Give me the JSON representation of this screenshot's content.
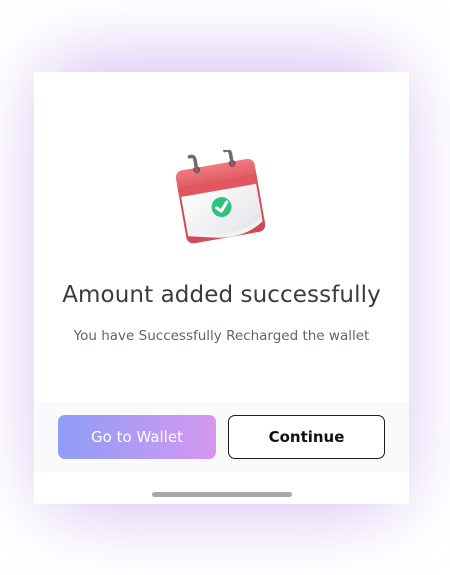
{
  "dialog": {
    "title": "Amount added successfully",
    "message": "You have Successfully Recharged the wallet"
  },
  "illustration": {
    "icon": "calendar-check-icon"
  },
  "actions": {
    "wallet_label": "Go to Wallet",
    "continue_label": "Continue"
  },
  "colors": {
    "calendar_red": "#e9636a",
    "check_green": "#2ec27e",
    "title_text": "#3b3b3f",
    "subtitle_text": "#5f6470",
    "gradient_start": "#8f9cf6",
    "gradient_end": "#d597f0"
  }
}
